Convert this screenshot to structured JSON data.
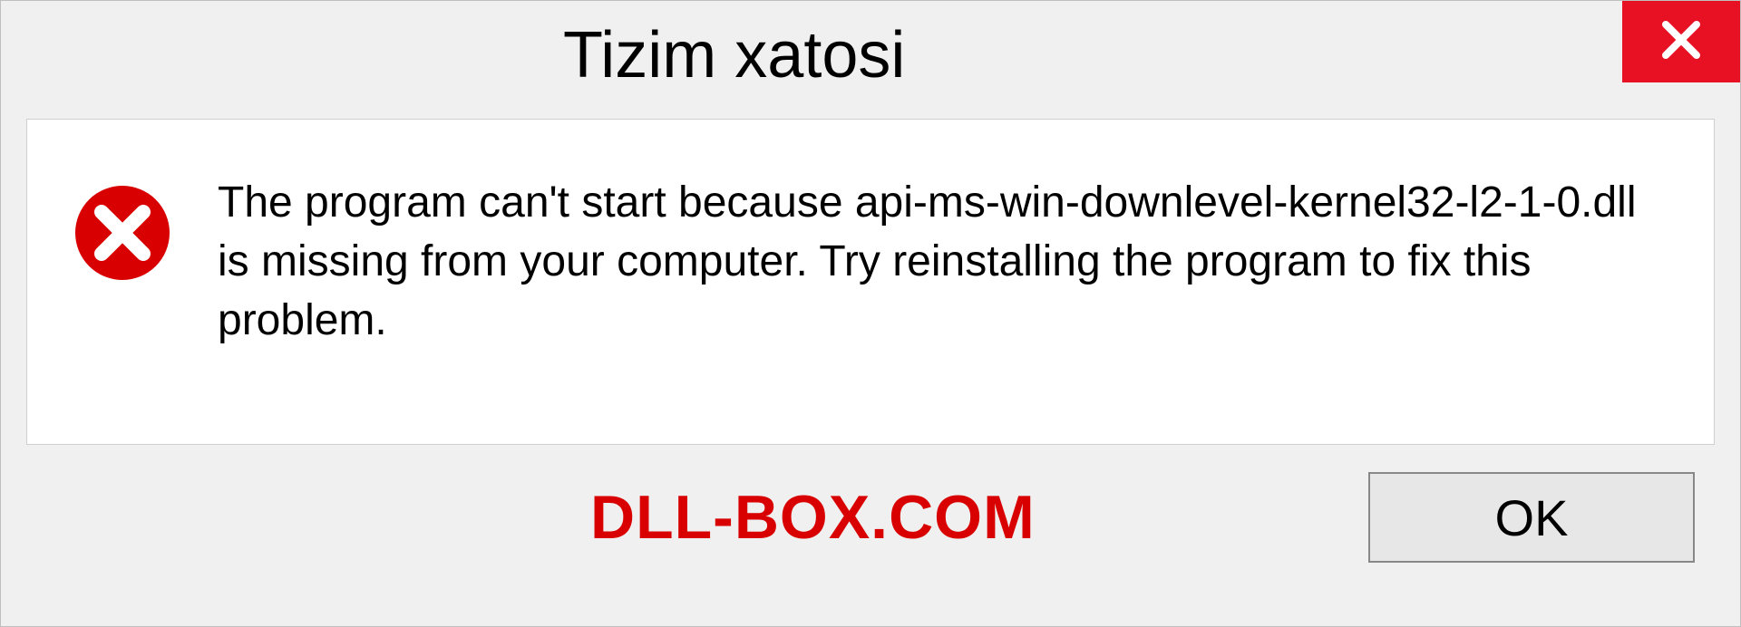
{
  "dialog": {
    "title": "Tizim xatosi",
    "message": "The program can't start because api-ms-win-downlevel-kernel32-l2-1-0.dll is missing from your computer. Try reinstalling the program to fix this problem.",
    "ok_label": "OK"
  },
  "watermark": "DLL-BOX.COM",
  "colors": {
    "close_bg": "#e81123",
    "error_red": "#d80000"
  }
}
